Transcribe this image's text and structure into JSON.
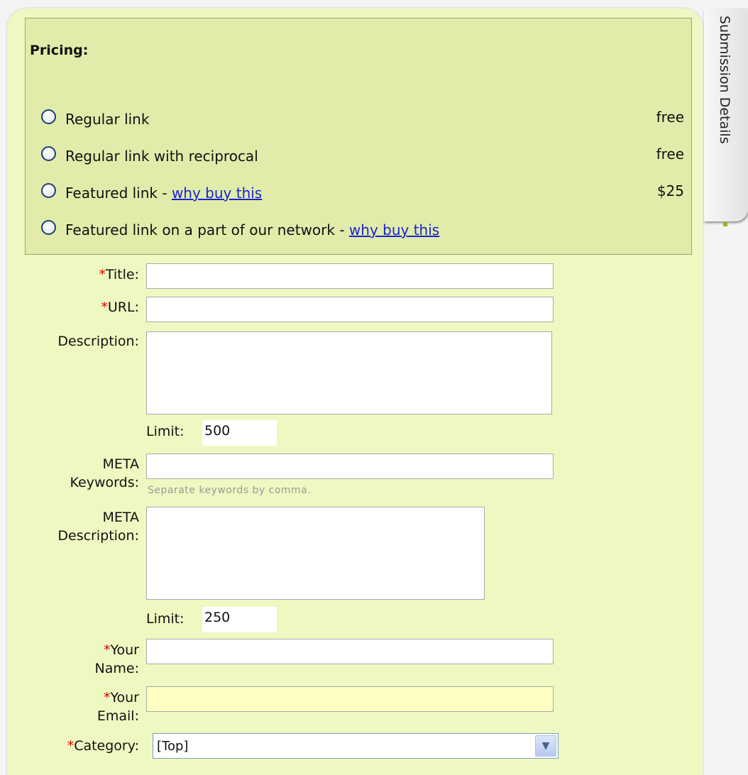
{
  "pricing": {
    "title": "Pricing:",
    "options": [
      {
        "label": "Regular link",
        "price": "free"
      },
      {
        "label": "Regular link with reciprocal",
        "price": "free"
      },
      {
        "label": "Featured link - ",
        "link": "why buy this",
        "price": "$25"
      },
      {
        "label": "Featured link on a part of our network - ",
        "link": "why buy this",
        "price": ""
      }
    ]
  },
  "form": {
    "title_label": "Title:",
    "url_label": "URL:",
    "description_label": "Description:",
    "description_limit_label": "Limit:",
    "description_limit_value": "500",
    "meta_keywords_label_1": "META",
    "meta_keywords_label_2": "Keywords:",
    "meta_keywords_hint": "Separate keywords by comma.",
    "meta_description_label_1": "META",
    "meta_description_label_2": "Description:",
    "meta_description_limit_label": "Limit:",
    "meta_description_limit_value": "250",
    "your_name_label_1": "Your",
    "your_name_label_2": "Name:",
    "your_email_label_1": "Your",
    "your_email_label_2": "Email:",
    "category_label": "Category:",
    "category_value": "[Top]",
    "required_mark": "*"
  },
  "side_tab": {
    "label": "Submission Details"
  },
  "colors": {
    "panel_bg": "#eef9c2",
    "pricing_bg": "#e1ecaa",
    "required": "#e00000",
    "link": "#1a22d0",
    "email_field_bg": "#ffffc4"
  }
}
